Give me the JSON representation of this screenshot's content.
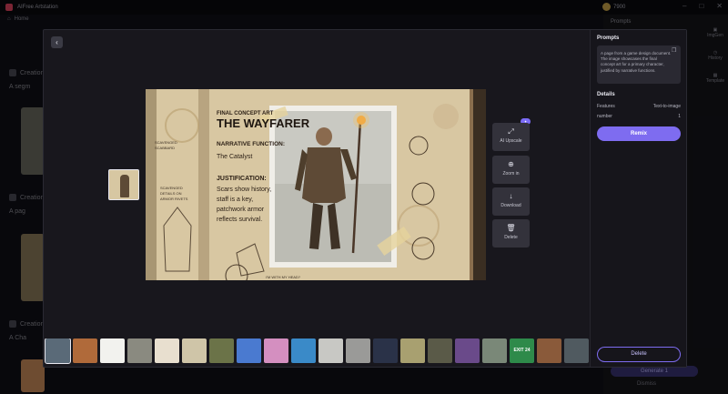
{
  "app": {
    "title": "AIFree Artstation",
    "credits": "7900",
    "home": "Home"
  },
  "background": {
    "rows": [
      "Creation",
      "A segm",
      "Creation",
      "A pag",
      "Creation",
      "A Cha"
    ],
    "right_panel_title": "Prompts",
    "side_items": [
      "ImgGen",
      "History",
      "Template"
    ],
    "generate_label": "Generate",
    "generate_count": "1",
    "dismiss_label": "Dismiss"
  },
  "toolbar": {
    "tools": [
      {
        "label": "AI Upscale",
        "icon": "expand-icon",
        "glyph": "⤢"
      },
      {
        "label": "Zoom in",
        "icon": "zoom-in-icon",
        "glyph": "⊕"
      },
      {
        "label": "Download",
        "icon": "download-icon",
        "glyph": "↓"
      },
      {
        "label": "Delete",
        "icon": "trash-icon",
        "glyph": "🗑"
      }
    ],
    "upscale_badge": "✦"
  },
  "image": {
    "heading_small": "FINAL CONCEPT ART",
    "heading_big": "THE WAYFARER",
    "narrative_label": "NARRATIVE FUNCTION:",
    "narrative_value": "The Catalyst",
    "justification_label": "JUSTIFICATION:",
    "justification_lines": [
      "Scars show history,",
      "staff is a key,",
      "patchwork armor",
      "reflects survival."
    ],
    "margin_notes": [
      "SCAVENGED",
      "SCABBARD",
      "SCAVENGED",
      "DETAILS ON",
      "ARMOR RIVETS",
      "I'M WITH MY HEAD?"
    ]
  },
  "panel": {
    "prompts_title": "Prompts",
    "prompt_text": "A page from a game design document. The image showcases the final concept art for a primary character, justified by narrative functions.",
    "details_title": "Details",
    "details": [
      {
        "key": "Features",
        "value": "Text-to-image"
      },
      {
        "key": "number",
        "value": "1"
      }
    ],
    "remix_label": "Remix",
    "delete_label": "Delete"
  },
  "strip": {
    "thumb_colors": [
      "#5a6a78",
      "#b06a3a",
      "#f2f2ee",
      "#8a8a80",
      "#e8dfcf",
      "#cfc5a8",
      "#6b7348",
      "#4a7ad0",
      "#d48fc0",
      "#3a8ac8",
      "#c8c8c4",
      "#9a9a98",
      "#2a3248",
      "#a8a070",
      "#5a5a48",
      "#6a4a8a",
      "#7a8878",
      "#2e8a4a",
      "#8a5a3a",
      "#505a60"
    ],
    "thumb_labels": [
      "",
      "",
      "",
      "",
      "",
      "",
      "",
      "",
      "",
      "",
      "",
      "",
      "",
      "",
      "",
      "",
      "",
      "EXIT 24",
      "",
      ""
    ]
  }
}
